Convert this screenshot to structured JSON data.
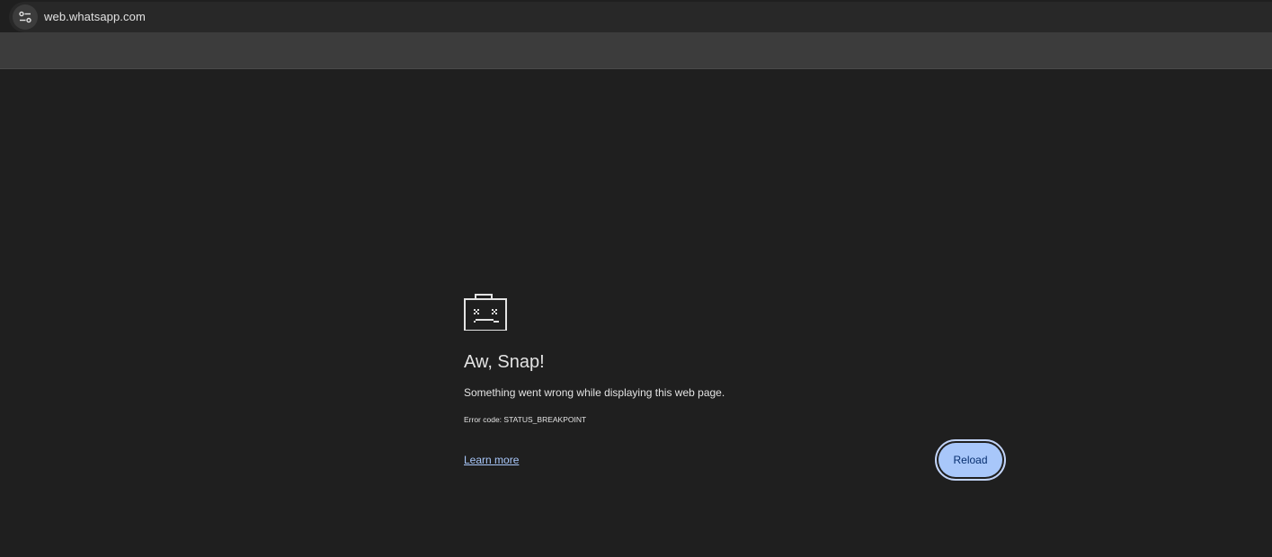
{
  "browser": {
    "url": "web.whatsapp.com",
    "site_info_icon": "tune-icon"
  },
  "error_page": {
    "icon": "sad-folder-icon",
    "title": "Aw, Snap!",
    "message": "Something went wrong while displaying this web page.",
    "error_code": "Error code: STATUS_BREAKPOINT",
    "learn_more": "Learn more",
    "reload": "Reload"
  },
  "colors": {
    "background": "#1f1f1f",
    "toolbar": "#3c3c3c",
    "text": "#e3e3e3",
    "link": "#a8c7fa",
    "button_fill": "#a8c7fa",
    "button_text": "#062e6f"
  }
}
